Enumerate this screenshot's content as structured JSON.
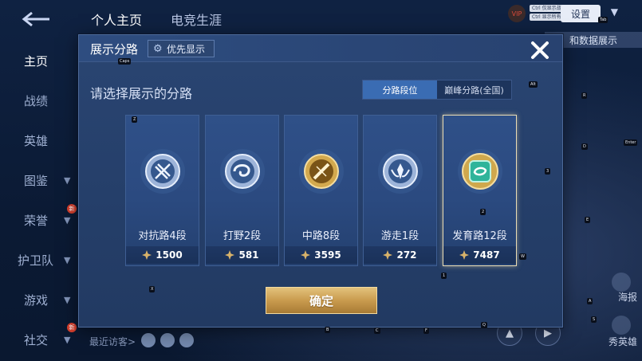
{
  "app": {
    "top_tabs": [
      "个人主页",
      "电竞生涯"
    ],
    "settings_label": "设置",
    "data_button_label": "和数据展示",
    "vip_label": "VIP",
    "mini_stats": [
      "Ctrl 仅显示战绩",
      "Ctrl 显示所有"
    ],
    "side_nav": [
      {
        "label": "主页",
        "active": true,
        "chevron": false,
        "badge": false
      },
      {
        "label": "战绩",
        "active": false,
        "chevron": false,
        "badge": false
      },
      {
        "label": "英雄",
        "active": false,
        "chevron": false,
        "badge": false
      },
      {
        "label": "图鉴",
        "active": false,
        "chevron": true,
        "badge": false
      },
      {
        "label": "荣誉",
        "active": false,
        "chevron": true,
        "badge": true
      },
      {
        "label": "护卫队",
        "active": false,
        "chevron": true,
        "badge": false
      },
      {
        "label": "游戏",
        "active": false,
        "chevron": true,
        "badge": false
      },
      {
        "label": "社交",
        "active": false,
        "chevron": true,
        "badge": true
      }
    ],
    "recent_visitors_label": "最近访客>",
    "right_labels": [
      "海报",
      "秀英雄"
    ],
    "badge_text": "新"
  },
  "dialog": {
    "title": "展示分路",
    "priority_button_label": "优先显示",
    "prompt": "请选择展示的分路",
    "segment_options": [
      {
        "label": "分路段位",
        "active": true
      },
      {
        "label": "巅峰分路(全国)",
        "active": false
      }
    ],
    "lanes": [
      {
        "name": "对抗路4段",
        "score": "1500",
        "emblem": "silver-sword-emblem",
        "selected": false
      },
      {
        "name": "打野2段",
        "score": "581",
        "emblem": "silver-swirl-emblem",
        "selected": false
      },
      {
        "name": "中路8段",
        "score": "3595",
        "emblem": "gold-staff-emblem",
        "selected": false
      },
      {
        "name": "游走1段",
        "score": "272",
        "emblem": "silver-wings-emblem",
        "selected": false
      },
      {
        "name": "发育路12段",
        "score": "7487",
        "emblem": "green-gem-emblem",
        "selected": true
      }
    ],
    "confirm_label": "确定",
    "colors": {
      "accent_gold": "#d9b36a",
      "segment_active": "#3a6cb3",
      "selected_border": "#e9dcb4"
    }
  },
  "hotkeys": [
    "Caps",
    "Alt",
    "R",
    "D",
    "Enter",
    "3",
    "E",
    "2",
    "W",
    "1",
    "X",
    "Q",
    "A",
    "S",
    "B",
    "C",
    "F",
    "Z",
    "Tab"
  ]
}
